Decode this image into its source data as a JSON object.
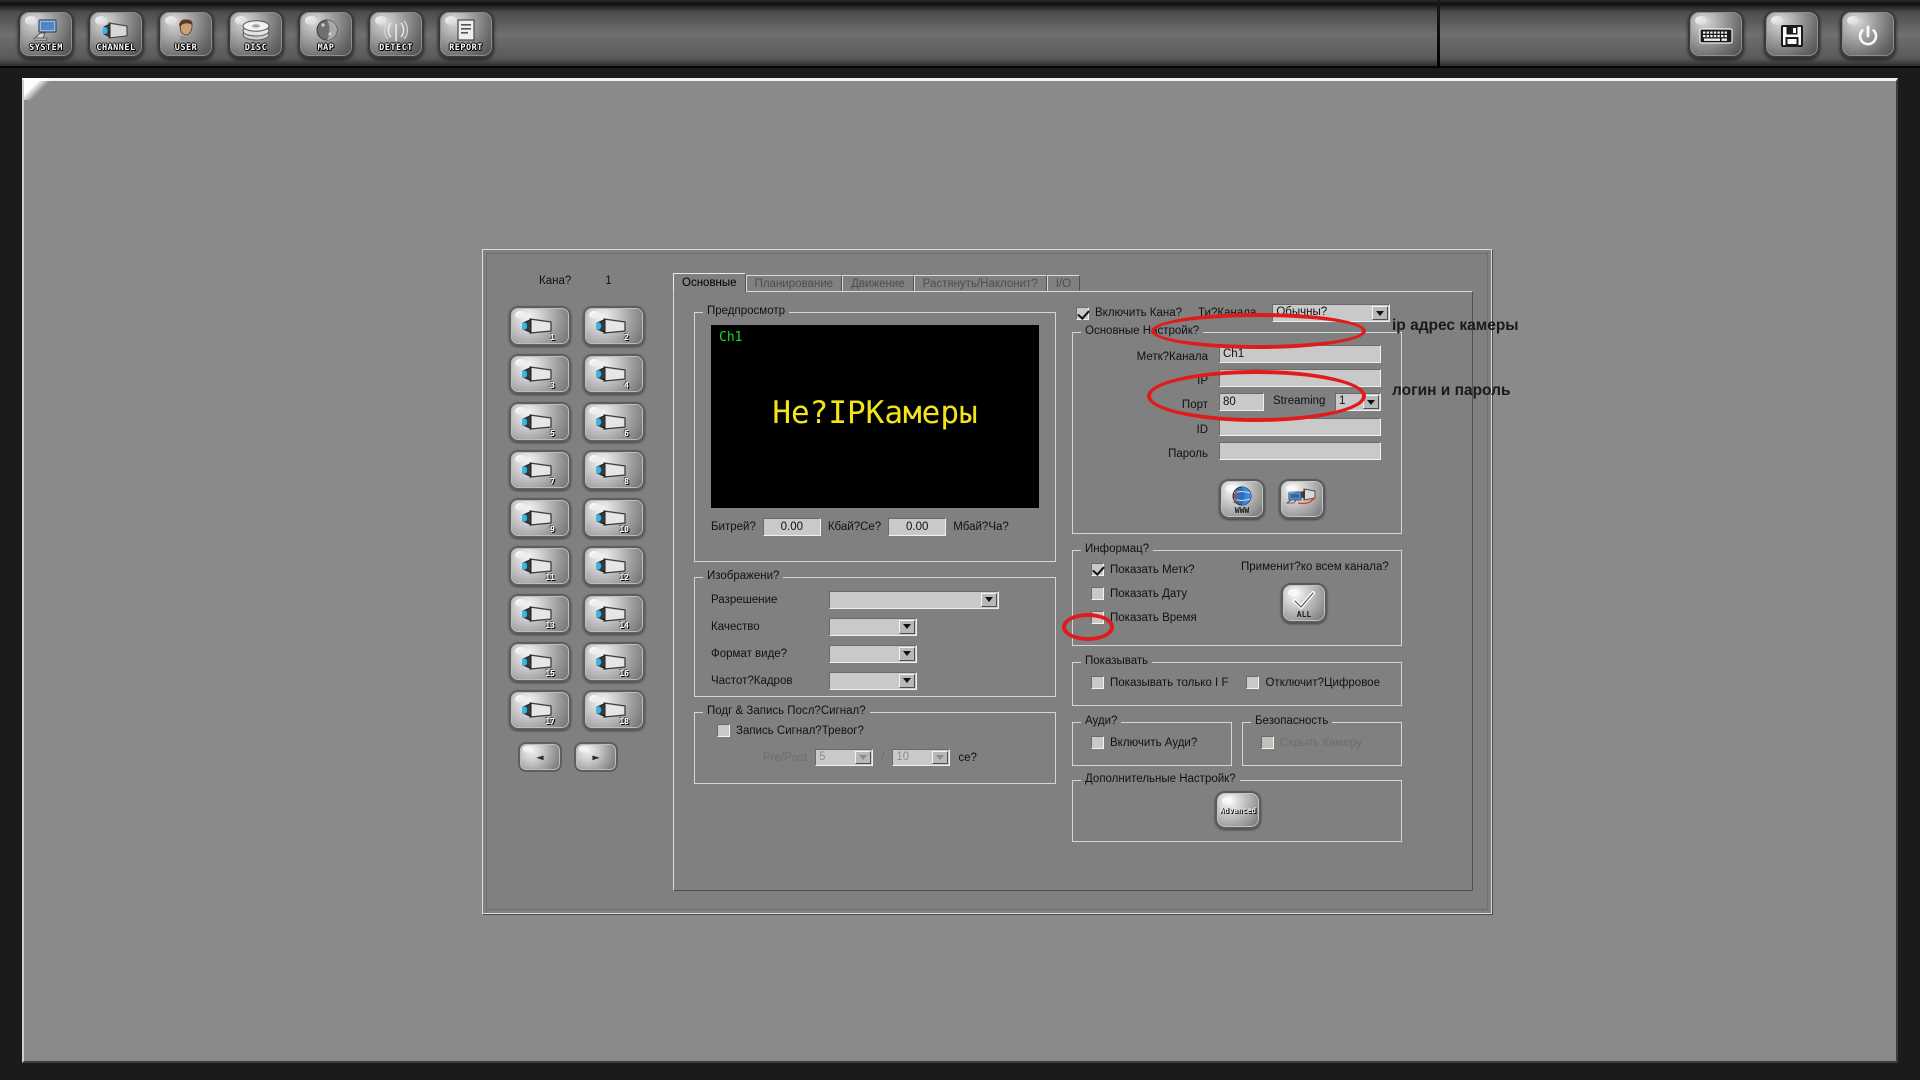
{
  "toolbar": {
    "left_buttons": [
      {
        "label": "SYSTEM",
        "icon": "computer-icon"
      },
      {
        "label": "CHANNEL",
        "icon": "camera-icon"
      },
      {
        "label": "USER",
        "icon": "user-icon"
      },
      {
        "label": "DISC",
        "icon": "disc-icon"
      },
      {
        "label": "MAP",
        "icon": "map-icon"
      },
      {
        "label": "DETECT",
        "icon": "antenna-icon"
      },
      {
        "label": "REPORT",
        "icon": "report-icon"
      }
    ],
    "right_buttons": [
      {
        "name": "keyboard-button",
        "icon": "keyboard-icon"
      },
      {
        "name": "save-button",
        "icon": "floppy-disk-icon"
      },
      {
        "name": "power-button",
        "icon": "power-icon"
      }
    ]
  },
  "channel_panel": {
    "label": "Кана?",
    "value": "1",
    "cameras": [
      "1",
      "2",
      "3",
      "4",
      "5",
      "6",
      "7",
      "8",
      "9",
      "10",
      "11",
      "12",
      "13",
      "14",
      "15",
      "16",
      "17",
      "18"
    ],
    "prev_glyph": "◄",
    "next_glyph": "►"
  },
  "tabs": [
    {
      "label": "Основные",
      "active": true
    },
    {
      "label": "Планирование",
      "active": false
    },
    {
      "label": "Движение",
      "active": false
    },
    {
      "label": "Растянуть/Наклонит?",
      "active": false
    },
    {
      "label": "I/O",
      "active": false
    }
  ],
  "preview": {
    "group_title": "Предпросмотр",
    "channel_overlay": "Ch1",
    "message": "Не?IPКамеры",
    "bitrate_label": "Битрей?",
    "bitrate_value": "0.00",
    "bitrate_unit": "Кбай?Се?",
    "volume_value": "0.00",
    "volume_unit": "Мбай?Ча?"
  },
  "image_group": {
    "title": "Изображени?",
    "rows": [
      {
        "label": "Разрешение",
        "value": ""
      },
      {
        "label": "Качество",
        "value": ""
      },
      {
        "label": "Формат виде?",
        "value": ""
      },
      {
        "label": "Частот?Кадров",
        "value": ""
      }
    ]
  },
  "prepost_group": {
    "title": "Подг & Запись Посл?Сигнал?",
    "checkbox_label": "Запись Сигнал?Тревог?",
    "checked": false,
    "pre_post_label": "Pre/Post",
    "pre_value": "5",
    "separator": "/",
    "post_value": "10",
    "unit": "ce?"
  },
  "channel_settings": {
    "enable_label": "Включить Кана?",
    "enable_checked": true,
    "type_label": "Ти?Канала",
    "type_value": "Обычны?",
    "group_title": "Основные Настройк?",
    "fields": [
      {
        "label": "Метк?Канала",
        "value": "Ch1"
      },
      {
        "label": "IP",
        "value": ""
      },
      {
        "label": "ID",
        "value": ""
      },
      {
        "label": "Пароль",
        "value": ""
      }
    ],
    "port_label": "Порт",
    "port_value": "80",
    "streaming_label": "Streaming",
    "streaming_value": "1",
    "www_button": "WWW",
    "www_icon": "globe-icon",
    "search_button_icon": "network-camera-icon"
  },
  "info_group": {
    "title": "Информац?",
    "checkboxes": [
      {
        "label": "Показать Метк?",
        "checked": true
      },
      {
        "label": "Показать Дату",
        "checked": false
      },
      {
        "label": "Показать Время",
        "checked": false
      }
    ],
    "apply_all_label": "Применит?ко всем канала?",
    "apply_all_button": "ALL"
  },
  "show_group": {
    "title": "Показывать",
    "checkboxes": [
      {
        "label": "Показывать только I F",
        "checked": false
      },
      {
        "label": "Отключит?Цифровое",
        "checked": false
      }
    ]
  },
  "audio_group": {
    "title": "Ауди?",
    "checkbox_label": "Включить Ауди?",
    "checked": false
  },
  "security_group": {
    "title": "Безопасность",
    "checkbox_label": "Скрыть Камеру",
    "checked": false
  },
  "advanced_group": {
    "title": "Дополнительные Настройк?",
    "button_label": "Advanced"
  },
  "annotations": [
    {
      "text": "ip адрес камеры"
    },
    {
      "text": "логин и пароль"
    }
  ],
  "colors": {
    "annotation_red": "#e01b1b",
    "overlay_green": "#1ddc1d",
    "overlay_yellow": "#f2e41c"
  }
}
